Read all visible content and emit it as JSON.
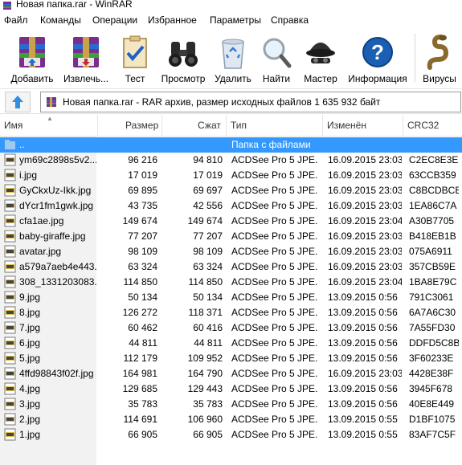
{
  "window": {
    "title": "Новая папка.rar - WinRAR"
  },
  "menu": [
    "Файл",
    "Команды",
    "Операции",
    "Избранное",
    "Параметры",
    "Справка"
  ],
  "toolbar": [
    {
      "id": "add",
      "label": "Добавить",
      "icon": "add-archive-icon"
    },
    {
      "id": "extract",
      "label": "Извлечь...",
      "icon": "extract-archive-icon"
    },
    {
      "id": "test",
      "label": "Тест",
      "icon": "test-checklist-icon"
    },
    {
      "id": "view",
      "label": "Просмотр",
      "icon": "binoculars-icon"
    },
    {
      "id": "delete",
      "label": "Удалить",
      "icon": "recycle-bin-icon"
    },
    {
      "id": "find",
      "label": "Найти",
      "icon": "magnifier-icon"
    },
    {
      "id": "wizard",
      "label": "Мастер",
      "icon": "wizard-hat-icon"
    },
    {
      "id": "info",
      "label": "Информация",
      "icon": "info-question-icon"
    },
    {
      "id": "virus",
      "label": "Вирусы",
      "icon": "snake-icon"
    }
  ],
  "address": {
    "text": "Новая папка.rar - RAR архив, размер исходных файлов 1 635 932 байт"
  },
  "columns": {
    "name": "Имя",
    "size": "Размер",
    "packed": "Сжат",
    "type": "Тип",
    "modified": "Изменён",
    "crc": "CRC32"
  },
  "parent_row": {
    "name": "..",
    "type": "Папка с файлами"
  },
  "files": [
    {
      "name": "ym69c2898s5v2...",
      "size": "96 216",
      "packed": "94 810",
      "type": "ACDSee Pro 5 JPE...",
      "modified": "16.09.2015 23:03",
      "crc": "C2EC8E3E"
    },
    {
      "name": "i.jpg",
      "size": "17 019",
      "packed": "17 019",
      "type": "ACDSee Pro 5 JPE...",
      "modified": "16.09.2015 23:03",
      "crc": "63CCB359"
    },
    {
      "name": "GyCkxUz-Ikk.jpg",
      "size": "69 895",
      "packed": "69 697",
      "type": "ACDSee Pro 5 JPE...",
      "modified": "16.09.2015 23:03",
      "crc": "C8BCDBCE"
    },
    {
      "name": "dYcr1fm1gwk.jpg",
      "size": "43 735",
      "packed": "42 556",
      "type": "ACDSee Pro 5 JPE...",
      "modified": "16.09.2015 23:03",
      "crc": "1EA86C7A"
    },
    {
      "name": "cfa1ae.jpg",
      "size": "149 674",
      "packed": "149 674",
      "type": "ACDSee Pro 5 JPE...",
      "modified": "16.09.2015 23:04",
      "crc": "A30B7705"
    },
    {
      "name": "baby-giraffe.jpg",
      "size": "77 207",
      "packed": "77 207",
      "type": "ACDSee Pro 5 JPE...",
      "modified": "16.09.2015 23:03",
      "crc": "B418EB1B"
    },
    {
      "name": "avatar.jpg",
      "size": "98 109",
      "packed": "98 109",
      "type": "ACDSee Pro 5 JPE...",
      "modified": "16.09.2015 23:03",
      "crc": "075A6911"
    },
    {
      "name": "a579a7aeb4e443...",
      "size": "63 324",
      "packed": "63 324",
      "type": "ACDSee Pro 5 JPE...",
      "modified": "16.09.2015 23:03",
      "crc": "357CB59E"
    },
    {
      "name": "308_1331203083...",
      "size": "114 850",
      "packed": "114 850",
      "type": "ACDSee Pro 5 JPE...",
      "modified": "16.09.2015 23:04",
      "crc": "1BA8E79C"
    },
    {
      "name": "9.jpg",
      "size": "50 134",
      "packed": "50 134",
      "type": "ACDSee Pro 5 JPE...",
      "modified": "13.09.2015 0:56",
      "crc": "791C3061"
    },
    {
      "name": "8.jpg",
      "size": "126 272",
      "packed": "118 371",
      "type": "ACDSee Pro 5 JPE...",
      "modified": "13.09.2015 0:56",
      "crc": "6A7A6C30"
    },
    {
      "name": "7.jpg",
      "size": "60 462",
      "packed": "60 416",
      "type": "ACDSee Pro 5 JPE...",
      "modified": "13.09.2015 0:56",
      "crc": "7A55FD30"
    },
    {
      "name": "6.jpg",
      "size": "44 811",
      "packed": "44 811",
      "type": "ACDSee Pro 5 JPE...",
      "modified": "13.09.2015 0:56",
      "crc": "DDFD5C8B"
    },
    {
      "name": "5.jpg",
      "size": "112 179",
      "packed": "109 952",
      "type": "ACDSee Pro 5 JPE...",
      "modified": "13.09.2015 0:56",
      "crc": "3F60233E"
    },
    {
      "name": "4ffd98843f02f.jpg",
      "size": "164 981",
      "packed": "164 790",
      "type": "ACDSee Pro 5 JPE...",
      "modified": "16.09.2015 23:03",
      "crc": "4428E38F"
    },
    {
      "name": "4.jpg",
      "size": "129 685",
      "packed": "129 443",
      "type": "ACDSee Pro 5 JPE...",
      "modified": "13.09.2015 0:56",
      "crc": "3945F678"
    },
    {
      "name": "3.jpg",
      "size": "35 783",
      "packed": "35 783",
      "type": "ACDSee Pro 5 JPE...",
      "modified": "13.09.2015 0:56",
      "crc": "40E8E449"
    },
    {
      "name": "2.jpg",
      "size": "114 691",
      "packed": "106 960",
      "type": "ACDSee Pro 5 JPE...",
      "modified": "13.09.2015 0:55",
      "crc": "D1BF1075"
    },
    {
      "name": "1.jpg",
      "size": "66 905",
      "packed": "66 905",
      "type": "ACDSee Pro 5 JPE...",
      "modified": "13.09.2015 0:55",
      "crc": "83AF7C5F"
    }
  ],
  "colors": {
    "selection": "#3399ff",
    "left_pane": "#f2f2f2",
    "accent": "#1a5fb4"
  }
}
